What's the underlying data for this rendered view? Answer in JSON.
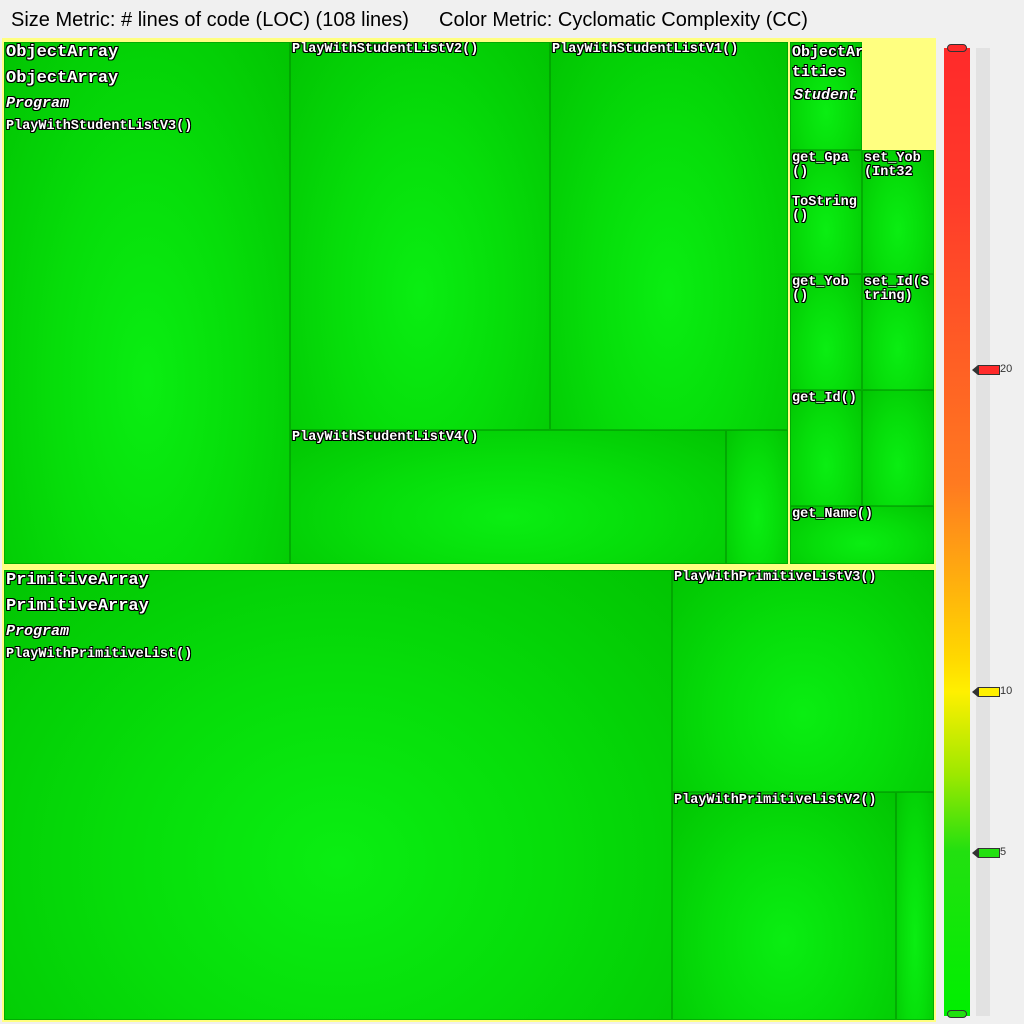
{
  "header": {
    "size_metric": "Size Metric: # lines of code (LOC) (108 lines)",
    "color_metric": "Color Metric: Cyclomatic Complexity (CC)"
  },
  "colors": {
    "low": "#00f000",
    "mid": "#fff000",
    "high": "#ff2a2a",
    "frame": "#ffff80"
  },
  "object_array": {
    "assembly": "ObjectArray",
    "namespace": "ObjectArray",
    "type": "Program",
    "methods": {
      "v3": "PlayWithStudentListV3()",
      "v2": "PlayWithStudentListV2()",
      "v1": "PlayWithStudentListV1()",
      "v4": "PlayWithStudentListV4()"
    },
    "entities": {
      "namespace": "ObjectArray.Entities",
      "type": "Student",
      "members": {
        "get_gpa": "get_Gpa()",
        "set_yob": "set_Yob(Int32",
        "to_string": "ToString()",
        "get_yob": "get_Yob()",
        "set_id": "set_Id(String)",
        "get_id": "get_Id()",
        "get_name": "get_Name()"
      }
    }
  },
  "primitive_array": {
    "assembly": "PrimitiveArray",
    "namespace": "PrimitiveArray",
    "type": "Program",
    "methods": {
      "list": "PlayWithPrimitiveList()",
      "v3": "PlayWithPrimitiveListV3()",
      "v2": "PlayWithPrimitiveListV2()"
    }
  },
  "legend": {
    "ticks": [
      "20",
      "10",
      "5"
    ]
  }
}
